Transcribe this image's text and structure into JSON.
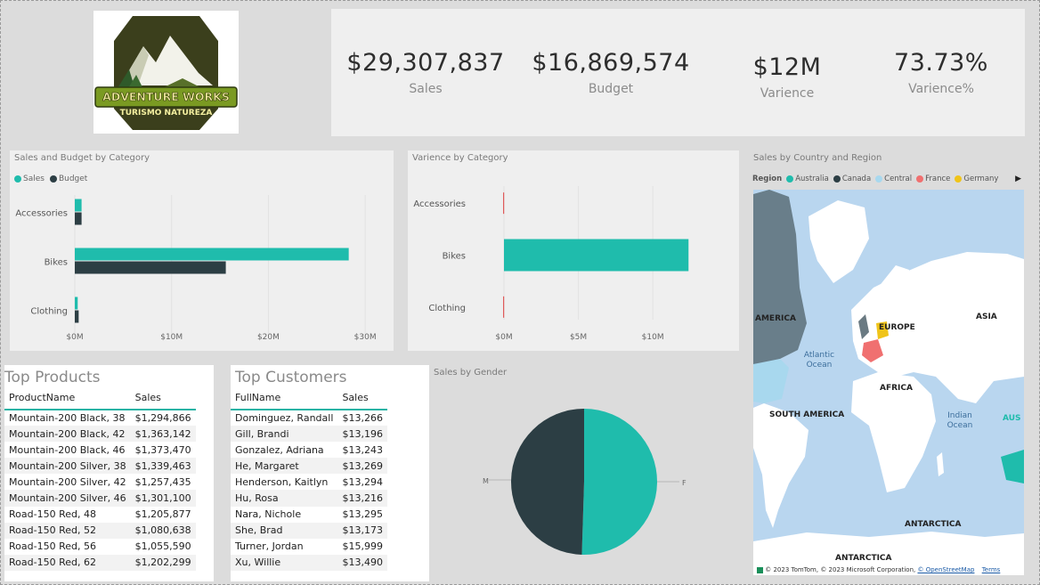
{
  "logo": {
    "line1": "ADVENTURE WORKS",
    "line2": "TURISMO NATUREZA"
  },
  "kpis": [
    {
      "value": "$29,307,837",
      "label": "Sales"
    },
    {
      "value": "$16,869,574",
      "label": "Budget"
    },
    {
      "value": "$12M",
      "label": "Varience"
    },
    {
      "value": "73.73%",
      "label": "Varience%"
    }
  ],
  "colors": {
    "sales": "#1fbcac",
    "budget": "#2c3e44",
    "red": "#e05a5a"
  },
  "chart_data": [
    {
      "type": "bar",
      "title": "Sales and Budget by Category",
      "categories": [
        "Accessories",
        "Bikes",
        "Clothing"
      ],
      "series": [
        {
          "name": "Sales",
          "values": [
            0.7,
            28.3,
            0.3
          ]
        },
        {
          "name": "Budget",
          "values": [
            0.7,
            15.6,
            0.4
          ]
        }
      ],
      "xticks": [
        "$0M",
        "$10M",
        "$20M",
        "$30M"
      ],
      "xlim": [
        0,
        31
      ],
      "unit": "$M",
      "legend": "top-left"
    },
    {
      "type": "bar",
      "title": "Varience by Category",
      "categories": [
        "Accessories",
        "Bikes",
        "Clothing"
      ],
      "values": [
        -0.05,
        12.4,
        -0.05
      ],
      "xticks": [
        "$0M",
        "$5M",
        "$10M"
      ],
      "xlim": [
        0,
        14
      ],
      "unit": "$M"
    },
    {
      "type": "pie",
      "title": "Sales by Gender",
      "labels": [
        "F",
        "M"
      ],
      "values": [
        50.5,
        49.5
      ]
    }
  ],
  "map": {
    "title": "Sales by Country and Region",
    "legend_header": "Region",
    "legend": [
      {
        "name": "Australia",
        "color": "#1fbcac"
      },
      {
        "name": "Canada",
        "color": "#2c3e44"
      },
      {
        "name": "Central",
        "color": "#a8d8ee"
      },
      {
        "name": "France",
        "color": "#f07070"
      },
      {
        "name": "Germany",
        "color": "#f0c419"
      }
    ],
    "labels": {
      "america": "AMERICA",
      "europe": "EUROPE",
      "asia": "ASIA",
      "africa": "AFRICA",
      "south_america": "SOUTH AMERICA",
      "antarctica": "ANTARCTICA",
      "antarctica2": "ANTARCTICA",
      "aus": "AUS",
      "atlantic": "Atlantic Ocean",
      "indian": "Indian Ocean"
    },
    "attribution": "© 2023 TomTom, © 2023 Microsoft Corporation, ",
    "attribution_link": "© OpenStreetMap",
    "terms": "Terms"
  },
  "top_products": {
    "title": "Top Products",
    "columns": [
      "ProductName",
      "Sales"
    ],
    "rows": [
      [
        "Mountain-200 Black, 38",
        "$1,294,866"
      ],
      [
        "Mountain-200 Black, 42",
        "$1,363,142"
      ],
      [
        "Mountain-200 Black, 46",
        "$1,373,470"
      ],
      [
        "Mountain-200 Silver, 38",
        "$1,339,463"
      ],
      [
        "Mountain-200 Silver, 42",
        "$1,257,435"
      ],
      [
        "Mountain-200 Silver, 46",
        "$1,301,100"
      ],
      [
        "Road-150 Red, 48",
        "$1,205,877"
      ],
      [
        "Road-150 Red, 52",
        "$1,080,638"
      ],
      [
        "Road-150 Red, 56",
        "$1,055,590"
      ],
      [
        "Road-150 Red, 62",
        "$1,202,299"
      ]
    ]
  },
  "top_customers": {
    "title": "Top Customers",
    "columns": [
      "FullName",
      "Sales"
    ],
    "rows": [
      [
        "Dominguez, Randall",
        "$13,266"
      ],
      [
        "Gill, Brandi",
        "$13,196"
      ],
      [
        "Gonzalez, Adriana",
        "$13,243"
      ],
      [
        "He, Margaret",
        "$13,269"
      ],
      [
        "Henderson, Kaitlyn",
        "$13,294"
      ],
      [
        "Hu, Rosa",
        "$13,216"
      ],
      [
        "Nara, Nichole",
        "$13,295"
      ],
      [
        "She, Brad",
        "$13,173"
      ],
      [
        "Turner, Jordan",
        "$15,999"
      ],
      [
        "Xu, Willie",
        "$13,490"
      ]
    ]
  }
}
